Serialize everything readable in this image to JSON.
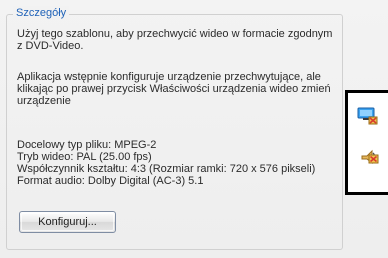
{
  "window": {
    "section_title": "Szczegóły"
  },
  "details_panel": {
    "description_1": "Użyj tego szablonu, aby przechwycić wideo w formacie zgodnym z DVD-Video.",
    "description_2": "Aplikacja wstępnie konfiguruje urządzenie przechwytujące, ale klikając po prawej przycisk Właściwości urządzenia wideo zmień urządzenie",
    "target_file_type": "Docelowy typ pliku: MPEG-2",
    "video_mode": "Tryb wideo: PAL (25.00 fps)",
    "aspect_ratio": "Współczynnik kształtu: 4:3 (Rozmiar ramki: 720 x 576 pikseli)",
    "audio_format": "Format audio: Dolby Digital (AC-3) 5.1",
    "configure_button": "Konfiguruj..."
  },
  "side_icons": [
    {
      "name": "video-device-properties-icon"
    },
    {
      "name": "audio-device-properties-icon"
    }
  ],
  "colors": {
    "title_blue": "#1f62b8",
    "panel_bg": "#f1f1f1",
    "border_black": "#000000"
  }
}
